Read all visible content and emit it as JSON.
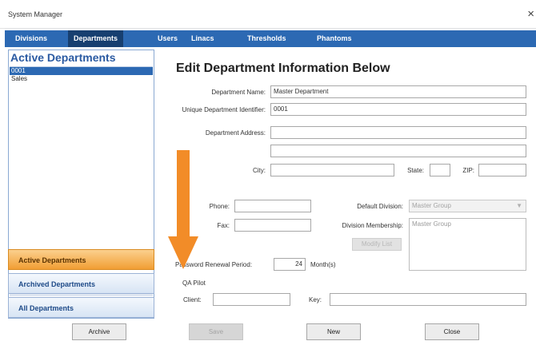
{
  "window": {
    "title": "System Manager",
    "close_icon": "close-icon",
    "close_glyph": "×"
  },
  "tabs": [
    {
      "label": "Divisions"
    },
    {
      "label": "Departments",
      "active": true
    },
    {
      "label": "Users"
    },
    {
      "label": "Linacs"
    },
    {
      "label": "Thresholds"
    },
    {
      "label": "Phantoms"
    }
  ],
  "sidebar": {
    "heading": "Active Departments",
    "items": [
      "0001",
      "Sales"
    ],
    "selected_index": 0,
    "nav": [
      {
        "label": "Active Departments",
        "active": true
      },
      {
        "label": "Archived Departments"
      },
      {
        "label": "All Departments"
      }
    ]
  },
  "form": {
    "title": "Edit Department Information Below",
    "department_name": {
      "label": "Department Name:",
      "value": "Master Department"
    },
    "identifier": {
      "label": "Unique Department Identifier:",
      "value": "0001"
    },
    "address": {
      "label": "Department Address:",
      "line1": "",
      "line2": ""
    },
    "city": {
      "label": "City:",
      "value": ""
    },
    "state": {
      "label": "State:",
      "value": ""
    },
    "zip": {
      "label": "ZIP:",
      "value": ""
    },
    "phone": {
      "label": "Phone:",
      "value": ""
    },
    "fax": {
      "label": "Fax:",
      "value": ""
    },
    "default_division": {
      "label": "Default Division:",
      "value": "Master Group",
      "arrow_icon": "chevron-down-icon"
    },
    "division_membership": {
      "label": "Division Membership:",
      "items": [
        "Master Group"
      ]
    },
    "modify_button": "Modify List",
    "password_renewal": {
      "label": "Password Renewal Period:",
      "value": "24",
      "unit": "Month(s)"
    },
    "qa_pilot": {
      "heading": "QA Pilot",
      "client_label": "Client:",
      "client_value": "",
      "key_label": "Key:",
      "key_value": ""
    }
  },
  "buttons": {
    "archive": "Archive",
    "save": "Save",
    "new": "New",
    "close": "Close"
  },
  "annotation": {
    "icon": "arrow-down-icon",
    "color": "#f28c28"
  },
  "colors": {
    "accent": "#2c69b3",
    "tab_active": "#173f70",
    "nav_active": "#f19e34"
  }
}
